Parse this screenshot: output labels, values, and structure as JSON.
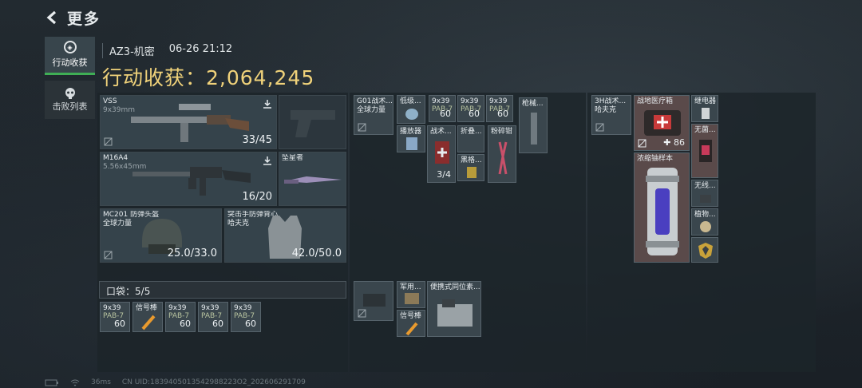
{
  "header": {
    "title": "更多"
  },
  "tabs": [
    {
      "label": "行动收获",
      "active": true
    },
    {
      "label": "击败列表",
      "active": false
    }
  ],
  "match": {
    "map": "AZ3-机密",
    "time": "06-26 21:12"
  },
  "haul": {
    "label": "行动收获：",
    "value": "2,064,245"
  },
  "gear": {
    "vss": {
      "name": "VSS",
      "sub": "9x39mm",
      "value": "33/45"
    },
    "m16": {
      "name": "M16A4",
      "sub": "5.56x45mm",
      "value": "16/20"
    },
    "knife": {
      "name": "坠星者"
    },
    "helmet": {
      "name": "MC201 防弹头盔",
      "sub": "全球力量",
      "value": "25.0/33.0"
    },
    "armor": {
      "name": "突击手防弹背心",
      "sub": "哈夫克",
      "value": "42.0/50.0"
    }
  },
  "pocket": {
    "label": "口袋：",
    "count": "5/5",
    "items": [
      {
        "name": "9x39",
        "sub": "PAB-7",
        "qty": "60"
      },
      {
        "name": "信号棒",
        "sub": "",
        "qty": ""
      },
      {
        "name": "9x39",
        "sub": "PAB-7",
        "qty": "60"
      },
      {
        "name": "9x39",
        "sub": "PAB-7",
        "qty": "60"
      },
      {
        "name": "9x39",
        "sub": "PAB-7",
        "qty": "60"
      }
    ]
  },
  "rig": {
    "rig_name": "G01战术...",
    "rig_sub": "全球力量",
    "low_name": "低级...",
    "ammo": [
      {
        "name": "9x39",
        "sub": "PAB-7",
        "qty": "60"
      },
      {
        "name": "9x39",
        "sub": "PAB-7",
        "qty": "60"
      },
      {
        "name": "9x39",
        "sub": "PAB-7",
        "qty": "60"
      }
    ],
    "player": "播放器",
    "tact": "战术...",
    "tact_qty": "3/4",
    "fold": "折叠...",
    "black": "黑格...",
    "pliers": "粉碎钳",
    "gun": "枪械..."
  },
  "bag": {
    "case_name": "军用...",
    "signal": "信号棒",
    "locator": "便携式同位素..."
  },
  "backpack": {
    "name": "3H战术...",
    "sub": "哈夫克",
    "medkit": "战地医疗箱",
    "medkit_qty": "86",
    "relay": "继电器",
    "nolabel": "无菌...",
    "sample": "浓缩铀样本",
    "wireless": "无线...",
    "plant": "植物..."
  },
  "footer": {
    "ping": "36ms",
    "uid": "CN UID:1839405013542988223O2_202606291709"
  },
  "colors": {
    "accent": "#3fae55",
    "gold": "#f0d27a"
  }
}
